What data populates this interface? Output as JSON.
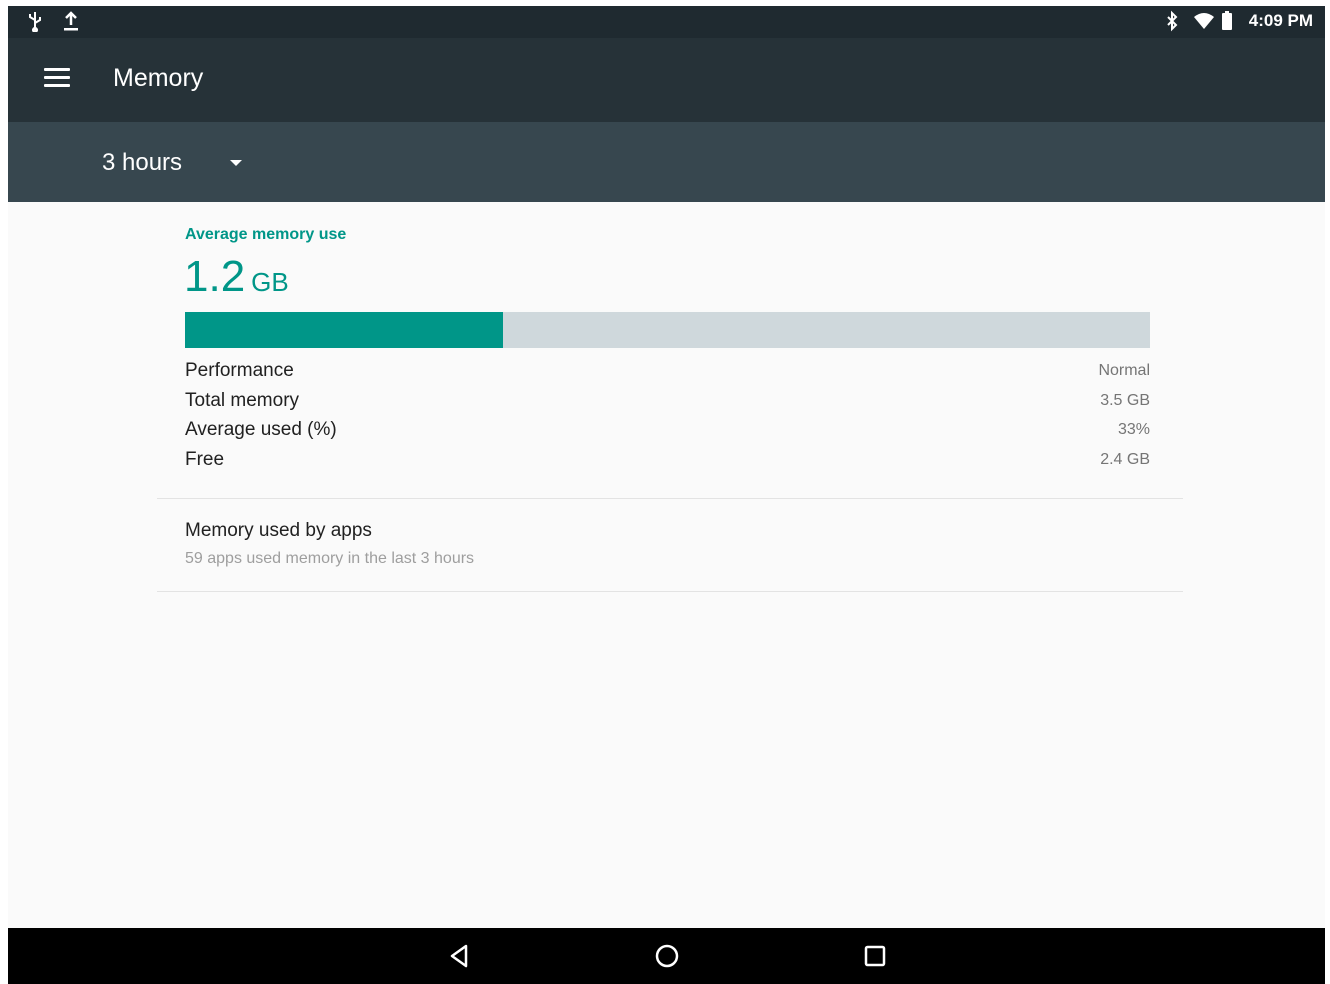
{
  "status_bar": {
    "time": "4:09 PM",
    "icons_left": [
      "usb-icon",
      "upload-icon"
    ],
    "icons_right": [
      "bluetooth-icon",
      "wifi-icon",
      "battery-icon"
    ]
  },
  "app_bar": {
    "title": "Memory",
    "menu_icon": "hamburger-menu-icon"
  },
  "filter": {
    "selected": "3 hours"
  },
  "summary": {
    "label": "Average memory use",
    "value": "1.2",
    "unit": "GB",
    "usage_fraction": 0.33,
    "accent_color": "#009688"
  },
  "stats": [
    {
      "label": "Performance",
      "value": "Normal"
    },
    {
      "label": "Total memory",
      "value": "3.5 GB"
    },
    {
      "label": "Average used (%)",
      "value": "33%"
    },
    {
      "label": "Free",
      "value": "2.4 GB"
    }
  ],
  "apps": {
    "title": "Memory used by apps",
    "subtitle": "59 apps used memory in the last 3 hours"
  },
  "nav_bar": {
    "buttons": [
      "back-icon",
      "home-icon",
      "recents-icon"
    ]
  }
}
